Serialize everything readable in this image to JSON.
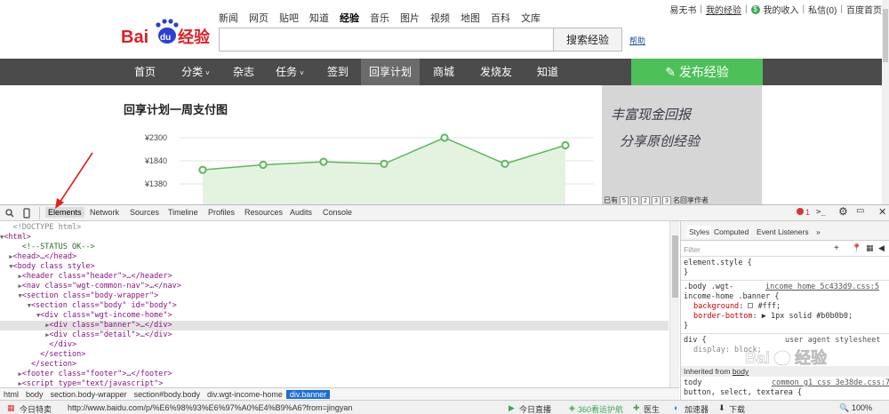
{
  "header": {
    "logo_text": "Bai du经验",
    "nav": [
      "新闻",
      "网页",
      "贴吧",
      "知道",
      "经验",
      "音乐",
      "图片",
      "视频",
      "地图",
      "百科",
      "文库"
    ],
    "nav_active": "经验",
    "search_placeholder": "",
    "search_button": "搜索经验",
    "help": "帮助",
    "user": [
      "易无书",
      "我的经验",
      "我的收入",
      "私信(0)",
      "百度首页"
    ]
  },
  "mainnav": {
    "items": [
      {
        "label": "首页",
        "caret": false
      },
      {
        "label": "分类",
        "caret": true
      },
      {
        "label": "杂志",
        "caret": false
      },
      {
        "label": "任务",
        "caret": true
      },
      {
        "label": "签到",
        "caret": false
      },
      {
        "label": "回享计划",
        "caret": false,
        "active": true
      },
      {
        "label": "商城",
        "caret": false
      },
      {
        "label": "发烧友",
        "caret": false
      },
      {
        "label": "知道",
        "caret": false
      }
    ],
    "publish": "发布经验"
  },
  "chart_data": {
    "type": "area",
    "title": "回享计划一周支付图",
    "yticks": [
      "¥2300",
      "¥1840",
      "¥1380"
    ],
    "ytick_values": [
      2300,
      1840,
      1380
    ],
    "values": [
      1660,
      1760,
      1820,
      1780,
      2300,
      1780,
      2150
    ],
    "color": "#5cb85c",
    "fill": "#e4f3e0"
  },
  "banner": {
    "line1": "丰富现金回报",
    "line2": "分享原创经验",
    "bottom_label": "已有",
    "digits": [
      "5",
      "5",
      "2",
      "3",
      "3"
    ],
    "bottom_suffix": "名回享作者"
  },
  "devtools": {
    "tabs": [
      "Elements",
      "Network",
      "Sources",
      "Timeline",
      "Profiles",
      "Resources",
      "Audits",
      "Console"
    ],
    "active_tab": "Elements",
    "error_count": "1",
    "breadcrumbs": [
      "html",
      "body",
      "section.body-wrapper",
      "section#body.body",
      "div.wgt-income-home",
      "div.banner"
    ],
    "styles_tabs": [
      "Styles",
      "Computed",
      "Event Listeners",
      "»"
    ],
    "filter_placeholder": "Filter",
    "styles": {
      "element_style": "element.style {",
      "close": "}",
      "rule1_sel_a": ".body .wgt-",
      "rule1_sel_b": "income-home .banner {",
      "rule1_src": "income_home_5c433d9.css:5",
      "rule1_p1_name": "background",
      "rule1_p1_val": "#fff;",
      "rule1_p2_name": "border-bottom",
      "rule1_p2_val": "1px solid #b0b0b0;",
      "rule2_sel": "div {",
      "rule2_src": "user agent stylesheet",
      "rule2_p": "display: block;",
      "inherited": "Inherited from",
      "inherited_link": "body",
      "rule3_sel": "tody",
      "rule3_src": "common_g1_css_3e38de.css:7",
      "rule3_b": "button, select, textarea {"
    },
    "dom": [
      {
        "t": "<!DOCTYPE html>",
        "indent": 1,
        "arrow": ""
      },
      {
        "t": "<html>",
        "indent": 0,
        "arrow": "▼"
      },
      {
        "t": "<!--STATUS OK-->",
        "indent": 2,
        "arrow": ""
      },
      {
        "t": "<head>…</head>",
        "indent": 1,
        "arrow": "▶"
      },
      {
        "t": "<body class style>",
        "indent": 1,
        "arrow": "▼"
      },
      {
        "t": "<header class=\"header\">…</header>",
        "indent": 2,
        "arrow": "▶"
      },
      {
        "t": "<nav class=\"wgt-common-nav\">…</nav>",
        "indent": 2,
        "arrow": "▶"
      },
      {
        "t": "<section class=\"body-wrapper\">",
        "indent": 2,
        "arrow": "▼"
      },
      {
        "t": "<section class=\"body\" id=\"body\">",
        "indent": 3,
        "arrow": "▼"
      },
      {
        "t": "<div class=\"wgt-income-home\">",
        "indent": 4,
        "arrow": "▼"
      },
      {
        "t": "<div class=\"banner\">…</div>",
        "indent": 5,
        "arrow": "▶",
        "sel": true
      },
      {
        "t": "<div class=\"detail\">…</div>",
        "indent": 5,
        "arrow": "▶"
      },
      {
        "t": "</div>",
        "indent": 5,
        "arrow": ""
      },
      {
        "t": "</section>",
        "indent": 4,
        "arrow": ""
      },
      {
        "t": "</section>",
        "indent": 3,
        "arrow": ""
      },
      {
        "t": "<footer class=\"footer\">…</footer>",
        "indent": 2,
        "arrow": "▶"
      },
      {
        "t": "<script type=\"text/javascript\">",
        "indent": 2,
        "arrow": "▶"
      }
    ]
  },
  "statusbar": {
    "left": "今日特卖",
    "url": "http://www.baidu.com/p/%E6%98%93%E6%97%A0%E4%B9%A6?from=jingyan",
    "live": "今日直播",
    "guard": "360看运护航",
    "doctor": "医生",
    "accel": "加速器",
    "download": "下载",
    "zoom": "100%"
  },
  "watermark": "Bai du经验"
}
